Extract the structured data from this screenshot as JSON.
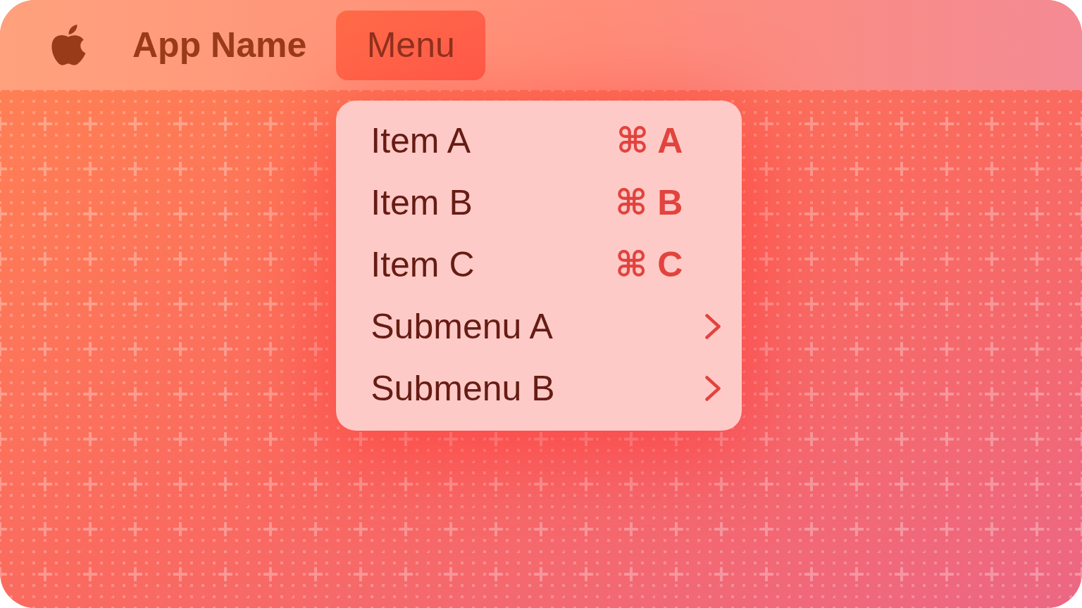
{
  "menu_bar": {
    "app_name": "App Name",
    "menu": {
      "label": "Menu",
      "expanded": true
    }
  },
  "dropdown": {
    "items": [
      {
        "kind": "item",
        "label": "Item A",
        "shortcut": "⌘ A"
      },
      {
        "kind": "item",
        "label": "Item B",
        "shortcut": "⌘ B"
      },
      {
        "kind": "item",
        "label": "Item C",
        "shortcut": "⌘ C"
      },
      {
        "kind": "submenu",
        "label": "Submenu A"
      },
      {
        "kind": "submenu",
        "label": "Submenu B"
      }
    ]
  }
}
